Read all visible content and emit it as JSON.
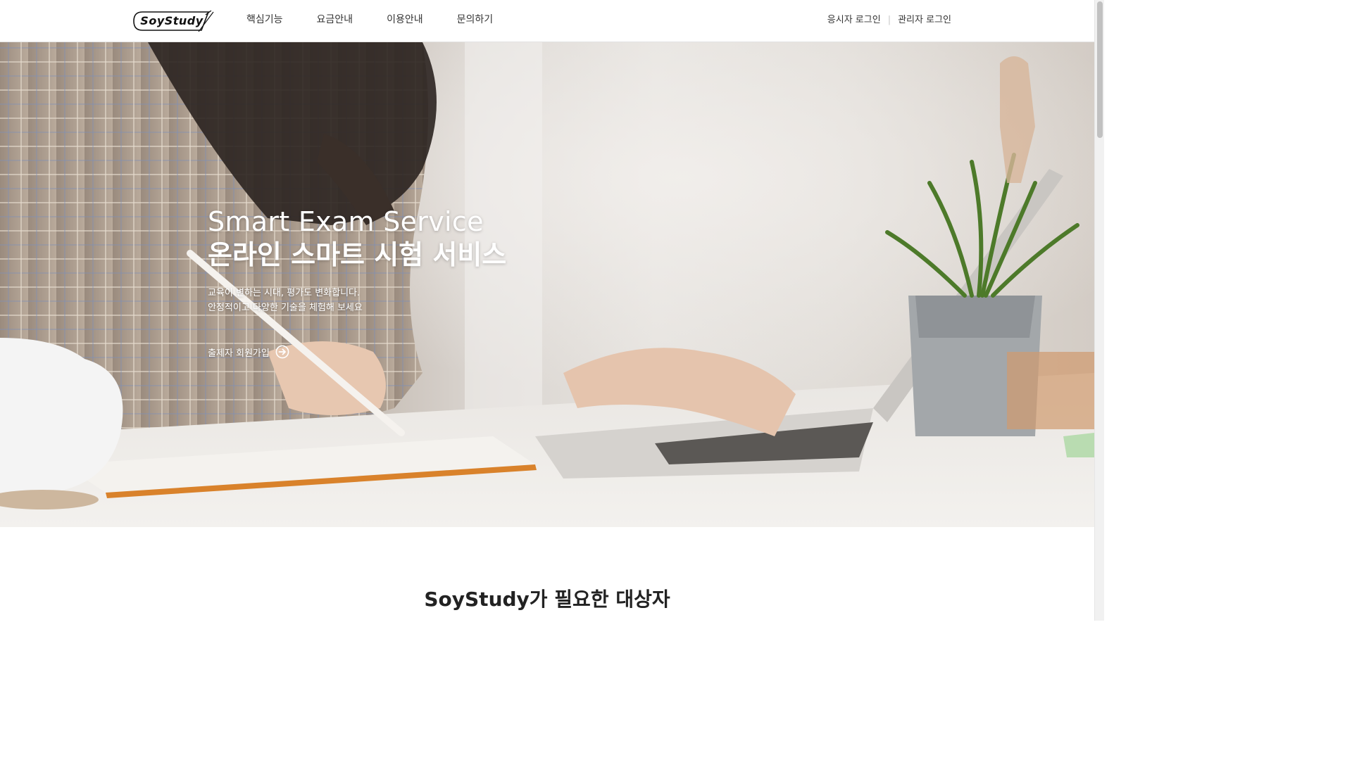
{
  "header": {
    "logo_text": "SoyStudy",
    "nav": [
      "핵심기능",
      "요금안내",
      "이용안내",
      "문의하기"
    ],
    "login": {
      "applicant": "응시자 로그인",
      "separator": "|",
      "admin": "관리자 로그인"
    }
  },
  "hero": {
    "title_en": "Smart Exam Service",
    "title_ko": "온라인 스마트 시험 서비스",
    "desc_line1": "교육이 변하는 시대, 평가도 변화합니다.",
    "desc_line2": "안정적이고 다양한 기술을 체험해 보세요",
    "cta_label": "출제자 회원가입",
    "cta_icon": "arrow-right-circle-icon"
  },
  "section": {
    "title": "SoyStudy가 필요한 대상자"
  },
  "colors": {
    "header_bg": "#ffffff",
    "hero_text": "#ffffff",
    "nav_text": "#333333",
    "section_title": "#222222"
  }
}
